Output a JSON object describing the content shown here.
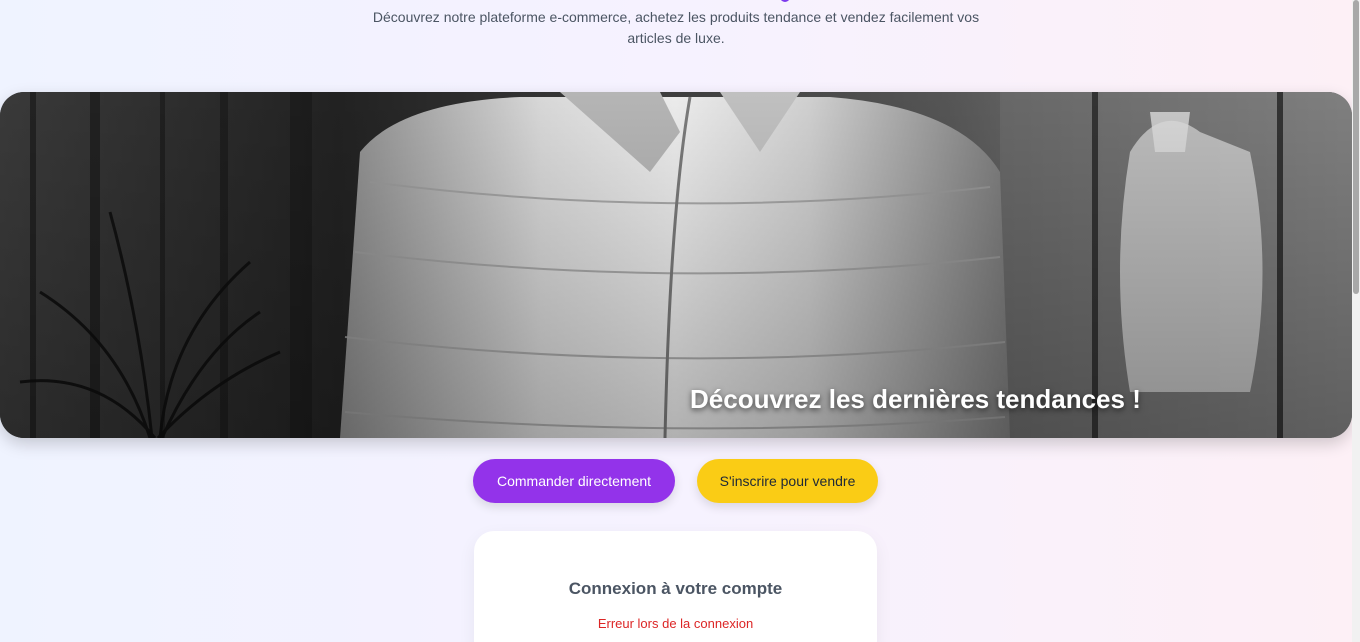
{
  "header": {
    "subtitle": "Découvrez notre plateforme e-commerce, achetez les produits tendance et vendez facilement vos articles de luxe."
  },
  "hero": {
    "image_description": "black-and-white puffer jacket in a shop window",
    "caption": "Découvrez les dernières tendances !"
  },
  "actions": {
    "order_label": "Commander directement",
    "sell_label": "S'inscrire pour vendre"
  },
  "login": {
    "title": "Connexion à votre compte",
    "error": "Erreur lors de la connexion"
  },
  "colors": {
    "primary": "#9333ea",
    "secondary": "#facc15",
    "error": "#dc2626"
  }
}
